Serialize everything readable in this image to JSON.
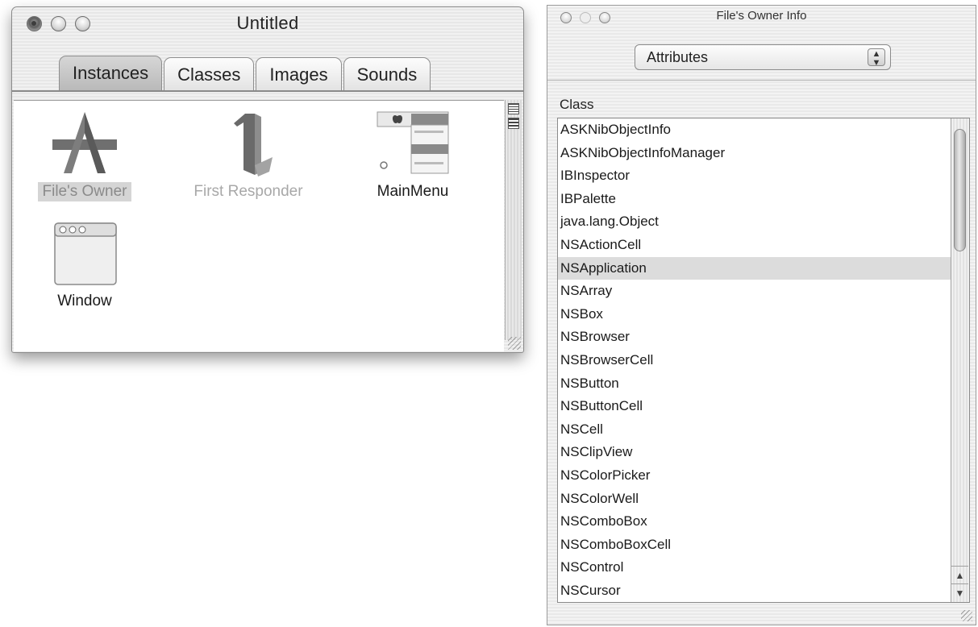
{
  "document_window": {
    "title": "Untitled",
    "tabs": [
      {
        "label": "Instances",
        "active": true
      },
      {
        "label": "Classes",
        "active": false
      },
      {
        "label": "Images",
        "active": false
      },
      {
        "label": "Sounds",
        "active": false
      }
    ],
    "instances": [
      {
        "label": "File's Owner",
        "icon": "app-icon",
        "selected": true
      },
      {
        "label": "First Responder",
        "icon": "first-responder-icon",
        "selected": false
      },
      {
        "label": "MainMenu",
        "icon": "main-menu-icon",
        "selected": false
      },
      {
        "label": "Window",
        "icon": "window-icon",
        "selected": false
      }
    ]
  },
  "inspector": {
    "title": "File's Owner Info",
    "popup_value": "Attributes",
    "class_header": "Class",
    "classes": [
      "ASKNibObjectInfo",
      "ASKNibObjectInfoManager",
      "IBInspector",
      "IBPalette",
      "java.lang.Object",
      "NSActionCell",
      "NSApplication",
      "NSArray",
      "NSBox",
      "NSBrowser",
      "NSBrowserCell",
      "NSButton",
      "NSButtonCell",
      "NSCell",
      "NSClipView",
      "NSColorPicker",
      "NSColorWell",
      "NSComboBox",
      "NSComboBoxCell",
      "NSControl",
      "NSCursor"
    ],
    "selected_class": "NSApplication"
  }
}
